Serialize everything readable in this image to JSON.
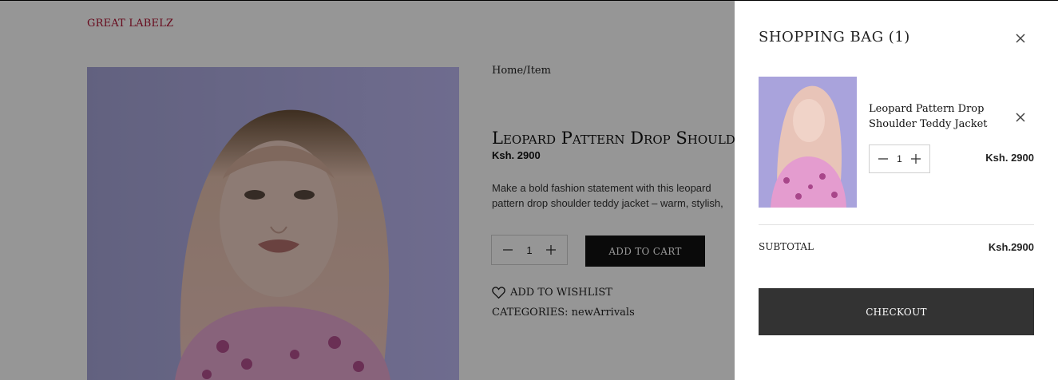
{
  "brand": "GREAT LABELZ",
  "breadcrumb": "Home/Item",
  "product": {
    "title": "Leopard Pattern Drop Shoulder Teddy Jacket",
    "price": "Ksh. 2900",
    "description": "Make a bold fashion statement with this leopard pattern drop shoulder teddy jacket – warm, stylish, and perfect for adding some flair to your outfit.",
    "quantity": "1",
    "add_to_cart_label": "ADD TO CART",
    "wishlist_label": "ADD TO WISHLIST",
    "categories_label": "CATEGORIES:",
    "category": "newArrivals"
  },
  "cart": {
    "title": "SHOPPING BAG (1)",
    "items": [
      {
        "name": "Leopard Pattern Drop Shoulder Teddy Jacket",
        "quantity": "1",
        "price": "Ksh. 2900"
      }
    ],
    "subtotal_label": "SUBTOTAL",
    "subtotal_value": "Ksh.2900",
    "checkout_label": "CHECKOUT"
  },
  "icons": {
    "close": "close-icon",
    "minus": "minus-icon",
    "plus": "plus-icon",
    "heart": "heart-icon"
  },
  "colors": {
    "brand": "#b01030",
    "button_dark": "#111111",
    "checkout": "#333333",
    "overlay": "rgba(0,0,0,0.41)"
  }
}
